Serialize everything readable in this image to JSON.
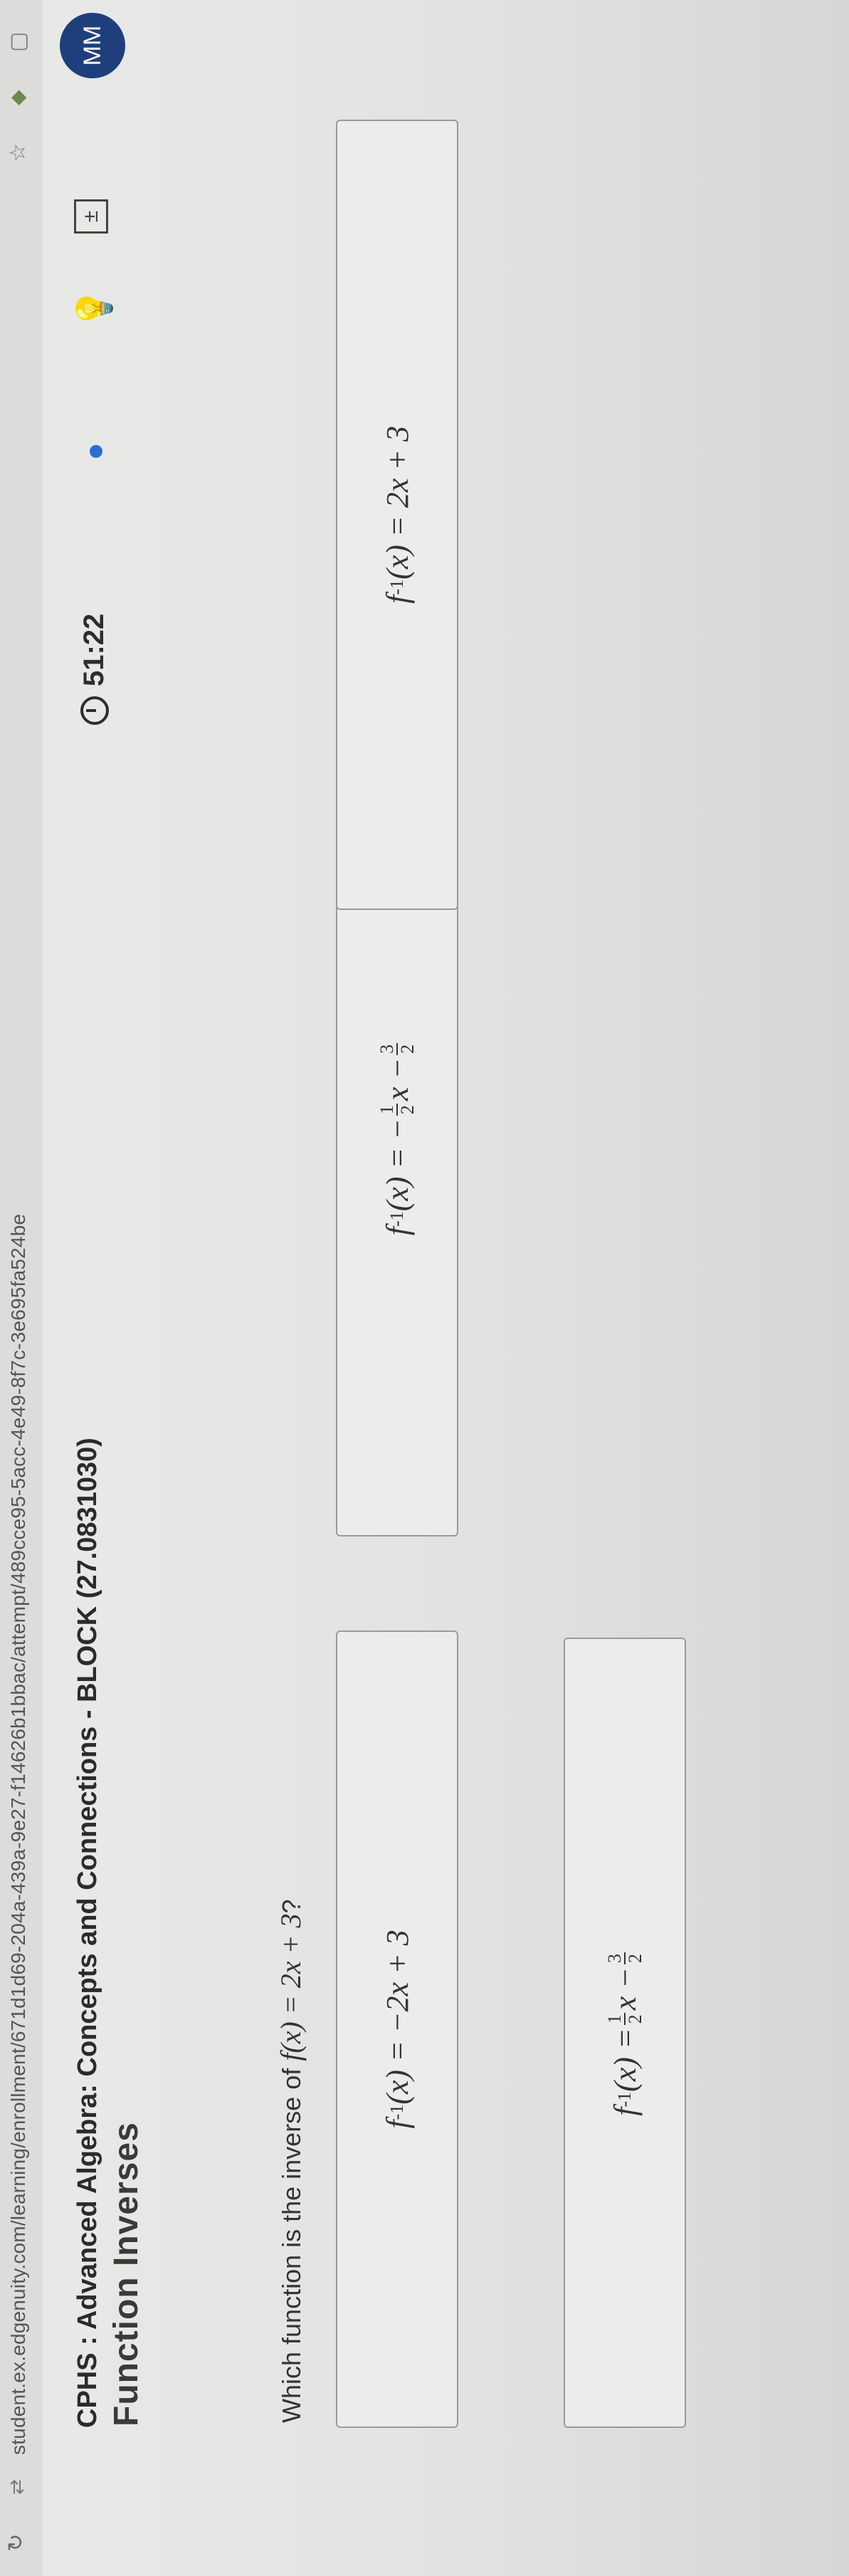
{
  "browser": {
    "url": "student.ex.edgenuity.com/learning/enrollment/671d1d69-204a-439a-9e27-f14626b1bbac/attempt/489cce95-5acc-4e49-8f7c-3e695fa524be"
  },
  "header": {
    "course_title": "CPHS : Advanced Algebra: Concepts and Connections - BLOCK (27.0831030)",
    "lesson_title": "Function Inverses",
    "timer": "51:22",
    "avatar_initials": "MM"
  },
  "question": {
    "prompt": "Which function is the inverse of",
    "function": "f(x) = 2x + 3",
    "end": "?"
  },
  "options": [
    {
      "id": "a",
      "lhs": "f",
      "sup": "-1",
      "mid": "(x) = −2x + 3"
    },
    {
      "id": "b",
      "lhs": "f",
      "sup": "-1",
      "mid": "(x) = −",
      "frac1_num": "1",
      "frac1_den": "2",
      "after1": "x −",
      "frac2_num": "3",
      "frac2_den": "2"
    },
    {
      "id": "c",
      "lhs": "f",
      "sup": "-1",
      "mid": "(x) = 2x + 3"
    },
    {
      "id": "d",
      "lhs": "f",
      "sup": "-1",
      "mid": "(x) =",
      "frac1_num": "1",
      "frac1_den": "2",
      "after1": "x −",
      "frac2_num": "3",
      "frac2_den": "2"
    }
  ],
  "colors": {
    "avatar_bg": "#1f3f7c",
    "status_dot": "#2a6fcf"
  },
  "icons": [
    "reload-icon",
    "site-info-icon",
    "star-icon",
    "extension-icon",
    "tab-icon",
    "timer-icon",
    "hint-icon",
    "calculator-icon"
  ]
}
